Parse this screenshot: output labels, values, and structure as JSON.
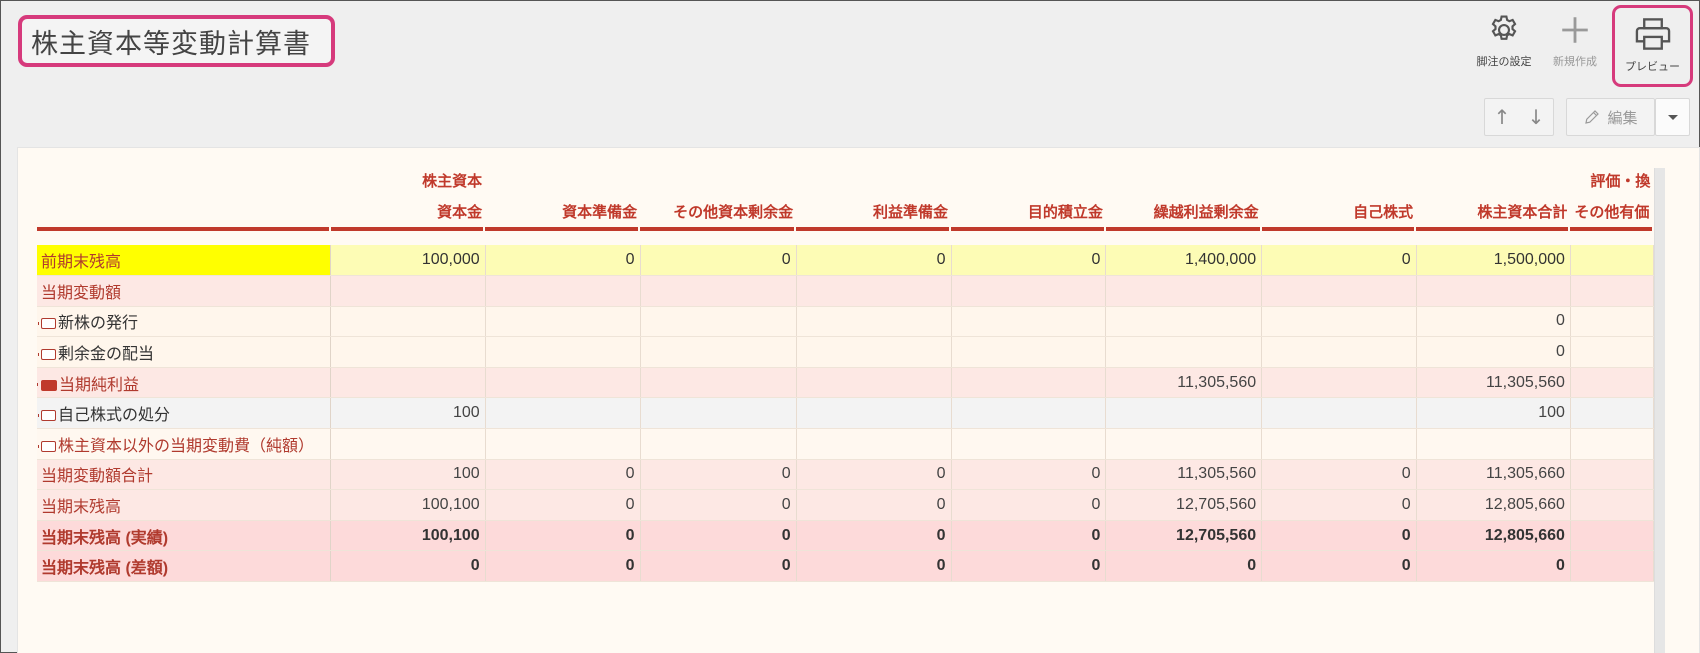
{
  "page": {
    "title": "株主資本等変動計算書"
  },
  "toolbar": {
    "settings_label": "脚注の設定",
    "new_label": "新規作成",
    "preview_label": "プレビュー",
    "edit_label": "編集",
    "up_glyph": "↑",
    "down_glyph": "↓"
  },
  "table": {
    "group_headers": {
      "shareholders_equity": "株主資本",
      "valuation": "評価・換"
    },
    "columns": [
      "資本金",
      "資本準備金",
      "その他資本剰余金",
      "利益準備金",
      "目的積立金",
      "繰越利益剰余金",
      "自己株式",
      "株主資本合計",
      "その他有価"
    ],
    "rows": [
      {
        "name": "前期末残高",
        "values": [
          "100,000",
          "0",
          "0",
          "0",
          "0",
          "1,400,000",
          "0",
          "1,500,000",
          ""
        ]
      },
      {
        "name": "当期変動額",
        "values": [
          "",
          "",
          "",
          "",
          "",
          "",
          "",
          "",
          ""
        ]
      },
      {
        "name": "新株の発行",
        "values": [
          "",
          "",
          "",
          "",
          "",
          "",
          "",
          "0",
          ""
        ]
      },
      {
        "name": "剰余金の配当",
        "values": [
          "",
          "",
          "",
          "",
          "",
          "",
          "",
          "0",
          ""
        ]
      },
      {
        "name": "当期純利益",
        "values": [
          "",
          "",
          "",
          "",
          "",
          "11,305,560",
          "",
          "11,305,560",
          ""
        ]
      },
      {
        "name": "自己株式の処分",
        "values": [
          "100",
          "",
          "",
          "",
          "",
          "",
          "",
          "100",
          ""
        ]
      },
      {
        "name": "株主資本以外の当期変動費（純額）",
        "values": [
          "",
          "",
          "",
          "",
          "",
          "",
          "",
          "",
          ""
        ]
      },
      {
        "name": "当期変動額合計",
        "values": [
          "100",
          "0",
          "0",
          "0",
          "0",
          "11,305,560",
          "0",
          "11,305,660",
          ""
        ]
      },
      {
        "name": "当期末残高",
        "values": [
          "100,100",
          "0",
          "0",
          "0",
          "0",
          "12,705,560",
          "0",
          "12,805,660",
          ""
        ]
      },
      {
        "name": "当期末残高 (実績)",
        "values": [
          "100,100",
          "0",
          "0",
          "0",
          "0",
          "12,705,560",
          "0",
          "12,805,660",
          ""
        ]
      },
      {
        "name": "当期末残高 (差額)",
        "values": [
          "0",
          "0",
          "0",
          "0",
          "0",
          "0",
          "0",
          "0",
          ""
        ]
      }
    ]
  },
  "colors": {
    "accent": "#c0392b",
    "highlight": "#d63a7c",
    "yellow": "#ffff00"
  }
}
